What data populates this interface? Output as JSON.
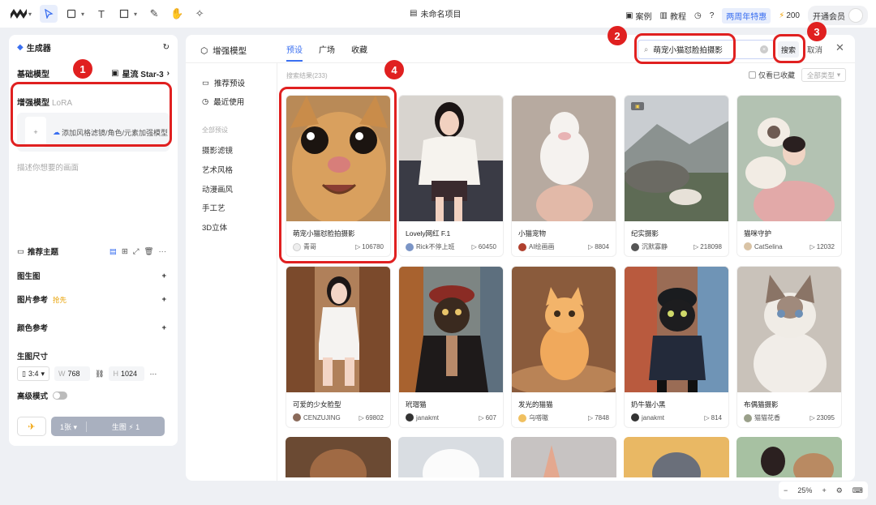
{
  "topbar": {
    "doc_title": "未命名项目",
    "cases": "案例",
    "tutorial": "教程",
    "promo": "两周年特惠",
    "credits": "200",
    "member": "开通会员"
  },
  "left_panel": {
    "generator": "生成器",
    "base_model_label": "基础模型",
    "base_model_value": "星流 Star-3",
    "enhance_label": "增强模型",
    "enhance_sub": "LoRA",
    "add_lora": "添加风格滤镜/角色/元素加强模型",
    "prompt_placeholder": "描述你想要的画面",
    "theme_label": "推荐主题",
    "img2img": "图生图",
    "img_ref": "图片参考",
    "img_ref_badge": "抢先",
    "color_ref": "颜色参考",
    "size_label": "生图尺寸",
    "ratio": "3:4",
    "width_label": "W",
    "width": "768",
    "height_label": "H",
    "height": "1024",
    "hd_mode": "高级模式",
    "count": "1张",
    "generate": "生图",
    "cost": "1"
  },
  "modal": {
    "title": "增强模型",
    "tabs": [
      "预设",
      "广场",
      "收藏"
    ],
    "search_value": "萌宠小猫怼脸拍摄影",
    "search_btn": "搜索",
    "cancel": "取消",
    "side": {
      "recommended": "推荐预设",
      "recent": "最近使用",
      "all_label": "全部预设",
      "categories": [
        "摄影滤镜",
        "艺术风格",
        "动漫画风",
        "手工艺",
        "3D立体"
      ]
    },
    "results": "搜索结果(233)",
    "only_favorites": "仅看已收藏",
    "all_types": "全部类型",
    "cards": [
      {
        "title": "萌宠小猫怼脸拍摄影",
        "author": "青哥",
        "uses": "106780"
      },
      {
        "title": "Lovely网红 F.1",
        "author": "Rick不停上班",
        "uses": "60450"
      },
      {
        "title": "小猫宠物",
        "author": "AI绘画画",
        "uses": "8804"
      },
      {
        "title": "纪实摄影",
        "author": "沉默寡静",
        "uses": "218098"
      },
      {
        "title": "猫咪守护",
        "author": "CatSelina",
        "uses": "12032"
      },
      {
        "title": "可爱的少女脸型",
        "author": "CENZUJING",
        "uses": "69802"
      },
      {
        "title": "玳瑁猫",
        "author": "janakmt",
        "uses": "607"
      },
      {
        "title": "发光的猫猫",
        "author": "乌嗒嗷",
        "uses": "7848"
      },
      {
        "title": "奶牛猫小黑",
        "author": "janakmt",
        "uses": "814"
      },
      {
        "title": "布偶猫摄影",
        "author": "猫猫花香",
        "uses": "23095"
      }
    ]
  },
  "zoom": {
    "minus": "−",
    "value": "25%",
    "plus": "+"
  },
  "annotations": [
    "1",
    "2",
    "3",
    "4"
  ],
  "colors": {
    "accent": "#3a6ff0",
    "highlight": "#e02020"
  }
}
